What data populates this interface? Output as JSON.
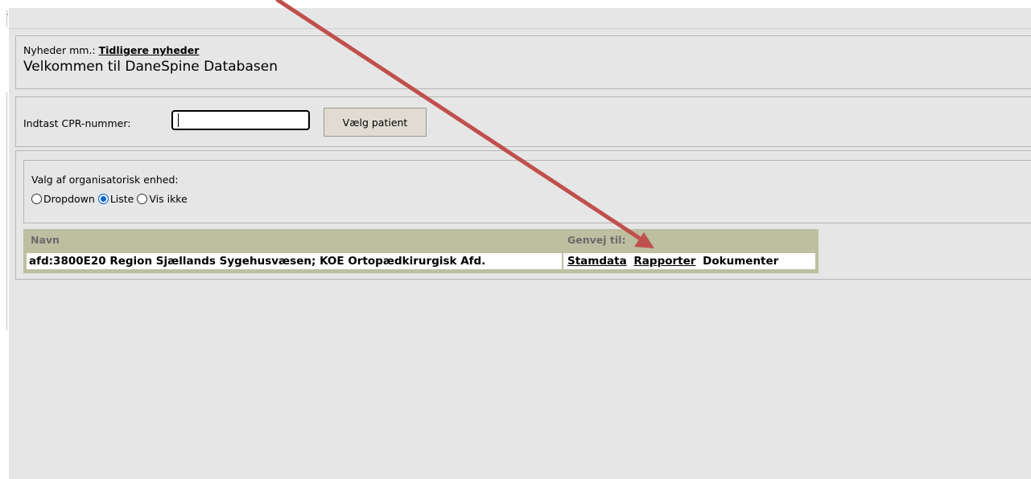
{
  "news": {
    "prefix": "Nyheder mm.:",
    "link": "Tidligere nyheder",
    "welcome": "Velkommen til DaneSpine Databasen"
  },
  "patient": {
    "cpr_label": "Indtast CPR-nummer:",
    "cpr_value": "",
    "select_button": "Vælg patient"
  },
  "org": {
    "label": "Valg af organisatorisk enhed:",
    "options": [
      {
        "label": "Dropdown",
        "checked": false
      },
      {
        "label": "Liste",
        "checked": true
      },
      {
        "label": "Vis ikke",
        "checked": false
      }
    ],
    "table": {
      "col_name": "Navn",
      "col_shortcut": "Genvej til:",
      "rows": [
        {
          "name": "afd:3800E20 Region Sjællands Sygehusvæsen; KOE Ortopædkirurgisk Afd.",
          "links": [
            "Stamdata",
            "Rapporter"
          ],
          "plain": "Dokumenter"
        }
      ]
    }
  },
  "colors": {
    "page_bg": "#e6e6e6",
    "table_header_bg": "#bdbfa0",
    "radio_selected": "#0a64d6",
    "arrow": "#c0504d",
    "button_bg": "#e0dcd2"
  }
}
